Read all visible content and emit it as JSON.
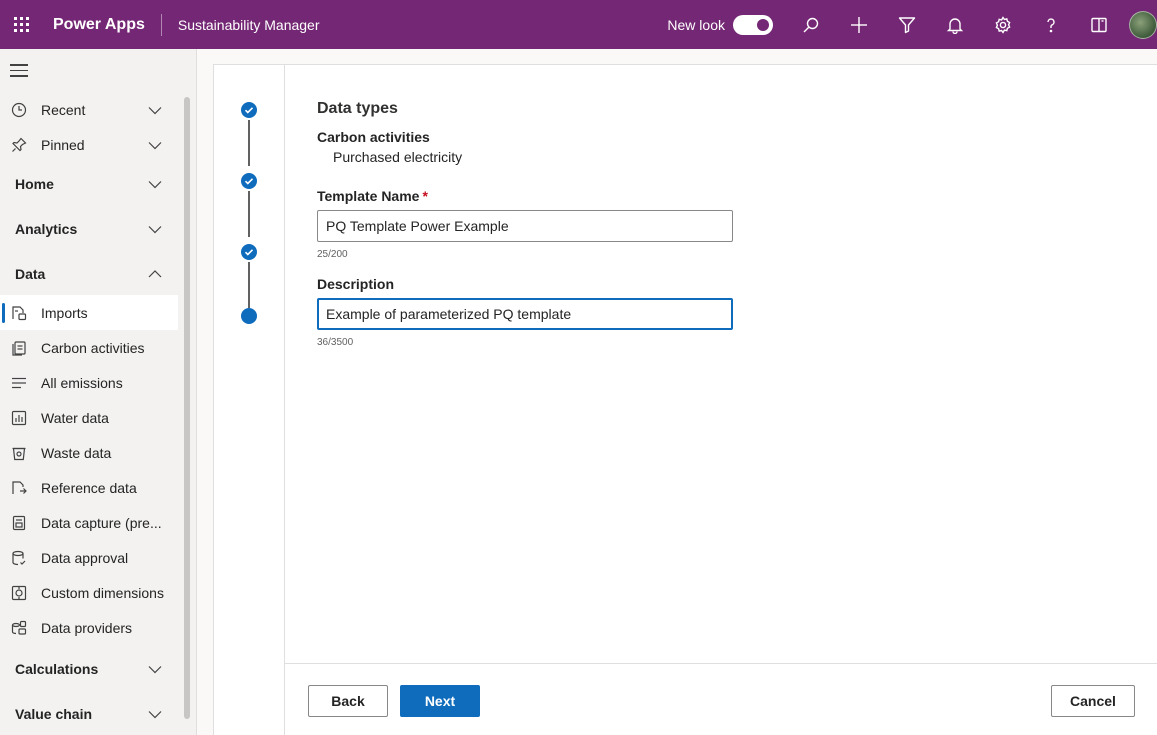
{
  "topbar": {
    "app_name": "Power Apps",
    "environment": "Sustainability Manager",
    "new_look_label": "New look",
    "new_look_on": true,
    "icons": [
      "search-icon",
      "plus-icon",
      "filter-icon",
      "bell-icon",
      "gear-icon",
      "help-icon",
      "book-icon"
    ]
  },
  "sidebar": {
    "recent": "Recent",
    "pinned": "Pinned",
    "groups": {
      "home": "Home",
      "analytics": "Analytics",
      "data": "Data",
      "calculations": "Calculations",
      "value_chain": "Value chain"
    },
    "data_items": [
      {
        "label": "Imports",
        "icon": "imports-icon",
        "active": true
      },
      {
        "label": "Carbon activities",
        "icon": "carbon-activities-icon"
      },
      {
        "label": "All emissions",
        "icon": "list-icon"
      },
      {
        "label": "Water data",
        "icon": "water-data-icon"
      },
      {
        "label": "Waste data",
        "icon": "waste-data-icon"
      },
      {
        "label": "Reference data",
        "icon": "reference-data-icon"
      },
      {
        "label": "Data capture (pre...",
        "icon": "data-capture-icon"
      },
      {
        "label": "Data approval",
        "icon": "data-approval-icon"
      },
      {
        "label": "Custom dimensions",
        "icon": "custom-dimensions-icon"
      },
      {
        "label": "Data providers",
        "icon": "data-providers-icon"
      }
    ]
  },
  "wizard": {
    "steps_completed": 3,
    "steps_total": 4,
    "section_title": "Data types",
    "sub_label": "Carbon activities",
    "sub_value": "Purchased electricity",
    "template_name_label": "Template Name",
    "required_mark": "*",
    "template_name_value": "PQ Template Power Example",
    "template_name_counter": "25/200",
    "description_label": "Description",
    "description_value": "Example of parameterized PQ template",
    "description_counter": "36/3500"
  },
  "footer": {
    "back_label": "Back",
    "next_label": "Next",
    "cancel_label": "Cancel"
  },
  "colors": {
    "header": "#742774",
    "accent": "#0f6cbd",
    "required": "#c50f1f"
  }
}
